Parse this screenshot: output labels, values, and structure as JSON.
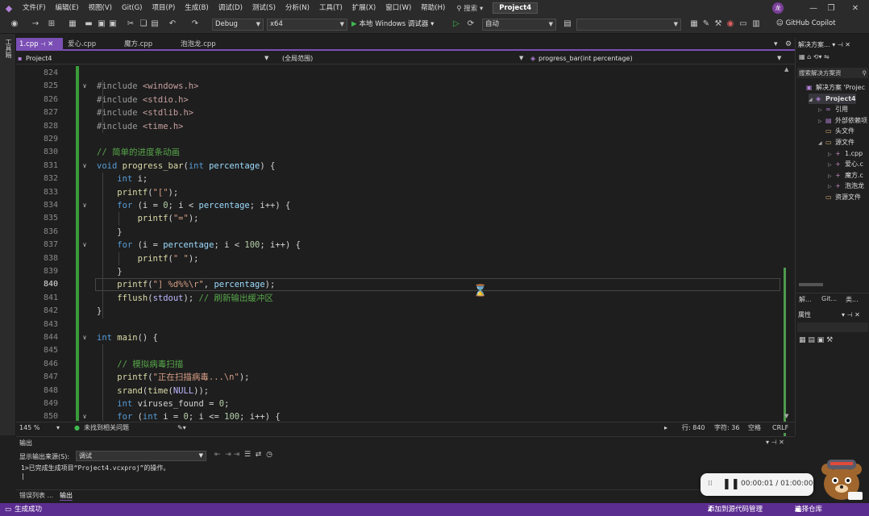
{
  "menu": {
    "items": [
      "文件(F)",
      "编辑(E)",
      "视图(V)",
      "Git(G)",
      "项目(P)",
      "生成(B)",
      "调试(D)",
      "测试(S)",
      "分析(N)",
      "工具(T)",
      "扩展(X)",
      "窗口(W)",
      "帮助(H)"
    ],
    "search_label": "搜索",
    "project": "Project4",
    "avatar_text": "龙"
  },
  "toolbar": {
    "config": "Debug",
    "platform": "x64",
    "run_label": "本地 Windows 调试器",
    "auto_label": "自动",
    "copilot": "GitHub Copilot"
  },
  "left_strip": "工具箱",
  "tabs": [
    {
      "label": "1.cpp"
    },
    {
      "label": "爱心.cpp"
    },
    {
      "label": "魔方.cpp"
    },
    {
      "label": "泡泡龙.cpp"
    }
  ],
  "nav": {
    "project": "Project4",
    "scope": "(全局范围)",
    "function": "progress_bar(int percentage)"
  },
  "code_lines": [
    {
      "n": "824",
      "html": ""
    },
    {
      "n": "825",
      "html": "<span class='pre'>#include</span> <span class='inc'>&lt;windows.h&gt;</span>"
    },
    {
      "n": "826",
      "html": "<span class='pre'>#include</span> <span class='inc'>&lt;stdio.h&gt;</span>"
    },
    {
      "n": "827",
      "html": "<span class='pre'>#include</span> <span class='inc'>&lt;stdlib.h&gt;</span>"
    },
    {
      "n": "828",
      "html": "<span class='pre'>#include</span> <span class='inc'>&lt;time.h&gt;</span>"
    },
    {
      "n": "829",
      "html": ""
    },
    {
      "n": "830",
      "html": "<span class='cmt'>// 简单的进度条动画</span>"
    },
    {
      "n": "831",
      "html": "<span class='kw'>void</span> <span class='fn'>progress_bar</span>(<span class='kw'>int</span> <span class='var'>percentage</span>) {"
    },
    {
      "n": "832",
      "html": "    <span class='kw'>int</span> <span class='txt'>i</span>;"
    },
    {
      "n": "833",
      "html": "    <span class='fn'>printf</span>(<span class='str'>\"[\"</span>);"
    },
    {
      "n": "834",
      "html": "    <span class='kw'>for</span> (<span class='txt'>i</span> = <span class='num'>0</span>; <span class='txt'>i</span> &lt; <span class='var'>percentage</span>; <span class='txt'>i</span>++) {"
    },
    {
      "n": "835",
      "html": "        <span class='fn'>printf</span>(<span class='str'>\"=\"</span>);"
    },
    {
      "n": "836",
      "html": "    }"
    },
    {
      "n": "837",
      "html": "    <span class='kw'>for</span> (<span class='txt'>i</span> = <span class='var'>percentage</span>; <span class='txt'>i</span> &lt; <span class='num'>100</span>; <span class='txt'>i</span>++) {"
    },
    {
      "n": "838",
      "html": "        <span class='fn'>printf</span>(<span class='str'>\" \"</span>);"
    },
    {
      "n": "839",
      "html": "    }"
    },
    {
      "n": "840",
      "html": "    <span class='fn'>printf</span>(<span class='str'>\"] %d%%\\r\"</span>, <span class='var'>percentage</span>);"
    },
    {
      "n": "841",
      "html": "    <span class='fn'>fflush</span>(<span class='mac'>stdout</span>); <span class='cmt'>// 刷新输出缓冲区</span>"
    },
    {
      "n": "842",
      "html": "}"
    },
    {
      "n": "843",
      "html": ""
    },
    {
      "n": "844",
      "html": "<span class='kw'>int</span> <span class='fn'>main</span>() {"
    },
    {
      "n": "845",
      "html": ""
    },
    {
      "n": "846",
      "html": "    <span class='cmt'>// 模拟病毒扫描</span>"
    },
    {
      "n": "847",
      "html": "    <span class='fn'>printf</span>(<span class='str'>\"正在扫描病毒...\\n\"</span>);"
    },
    {
      "n": "848",
      "html": "    <span class='fn'>srand</span>(<span class='fn'>time</span>(<span class='mac'>NULL</span>));"
    },
    {
      "n": "849",
      "html": "    <span class='kw'>int</span> <span class='txt'>viruses_found</span> = <span class='num'>0</span>;"
    },
    {
      "n": "850",
      "html": "    <span class='kw'>for</span> (<span class='kw'>int</span> <span class='txt'>i</span> = <span class='num'>0</span>; <span class='txt'>i</span> &lt;= <span class='num'>100</span>; <span class='txt'>i</span>++) {"
    }
  ],
  "editor_status": {
    "zoom": "145 %",
    "issues": "未找到相关问题",
    "line": "行: 840",
    "char": "字符: 36",
    "spaces": "空格",
    "eol": "CRLF"
  },
  "solution": {
    "title": "解决方案...",
    "search": "搜索解决方案资",
    "items": [
      {
        "label": "解决方案 'Projec",
        "icon": "▣",
        "indent": 0
      },
      {
        "label": "Project4",
        "icon": "◈",
        "indent": 1,
        "bold": true
      },
      {
        "label": "引用",
        "icon": "∞",
        "indent": 2
      },
      {
        "label": "外部依赖项",
        "icon": "▤",
        "indent": 2
      },
      {
        "label": "头文件",
        "icon": "▭",
        "indent": 2
      },
      {
        "label": "源文件",
        "icon": "▭",
        "indent": 2
      },
      {
        "label": "1.cpp",
        "icon": "+",
        "indent": 3
      },
      {
        "label": "爱心.c",
        "icon": "+",
        "indent": 3
      },
      {
        "label": "魔方.c",
        "icon": "+",
        "indent": 3
      },
      {
        "label": "泡泡龙",
        "icon": "+",
        "indent": 3
      },
      {
        "label": "资源文件",
        "icon": "▭",
        "indent": 2
      }
    ],
    "bottom_tabs": [
      "解...",
      "Git...",
      "类..."
    ]
  },
  "properties": {
    "title": "属性"
  },
  "output": {
    "title": "输出",
    "source_label": "显示输出来源(S):",
    "source_value": "调试",
    "text": "1>已完成生成项目“Project4.vcxproj”的操作。\n|"
  },
  "bottom_tabs": [
    "错误列表 ...",
    "输出"
  ],
  "app_status": {
    "left": "生成成功",
    "scm": "添加到源代码管理",
    "repo": "选择仓库"
  },
  "recorder": {
    "time": "00:00:01 / 01:00:00"
  }
}
